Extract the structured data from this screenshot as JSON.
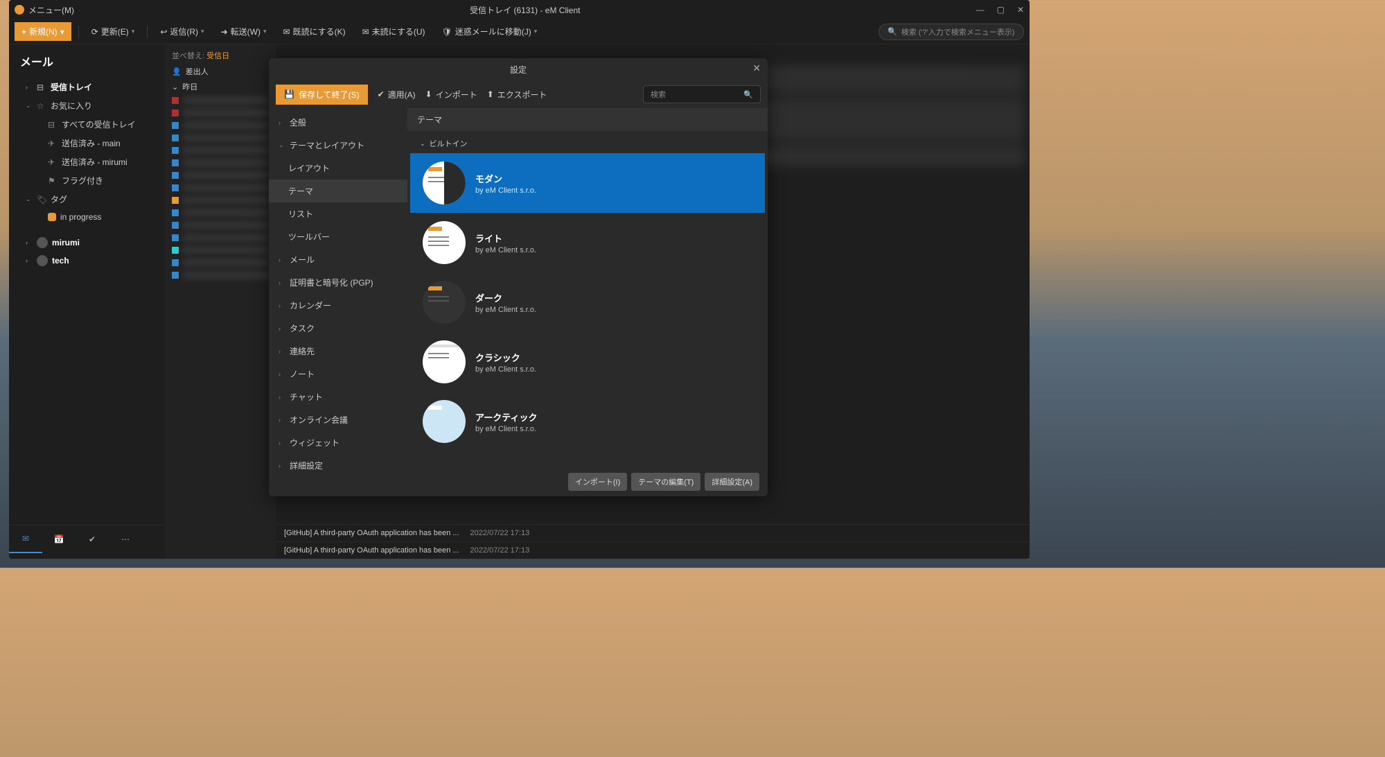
{
  "titlebar": {
    "menu": "メニュー(M)",
    "title": "受信トレイ (6131) - eM Client"
  },
  "toolbar": {
    "new": "新規(N)",
    "refresh": "更新(E)",
    "reply": "返信(R)",
    "forward": "転送(W)",
    "markread": "既読にする(K)",
    "markunread": "未読にする(U)",
    "junk": "迷惑メールに移動(J)",
    "search_ph": "検索 ('?'入力で検索メニュー表示)"
  },
  "sidebar": {
    "title": "メール",
    "inbox": "受信トレイ",
    "fav": "お気に入り",
    "allinbox": "すべての受信トレイ",
    "sent_main": "送信済み - main",
    "sent_mirumi": "送信済み - mirumi",
    "flagged": "フラグ付き",
    "tags": "タグ",
    "inprogress": "in progress",
    "acc1": "mirumi",
    "acc2": "tech"
  },
  "maillist": {
    "sortlabel": "並べ替え:",
    "sortval": "受信日",
    "sender": "差出人",
    "yesterday": "昨日",
    "visible1_subj": "[GitHub] A third-party OAuth application has been ...",
    "visible1_date": "2022/07/22 17:13",
    "visible2_subj": "[GitHub] A third-party OAuth application has been ...",
    "visible2_date": "2022/07/22 17:13"
  },
  "dialog": {
    "title": "設定",
    "save": "保存して終了(S)",
    "apply": "適用(A)",
    "import": "インポート",
    "export": "エクスポート",
    "search_ph": "検索",
    "nav": {
      "general": "全般",
      "themelayout": "テーマとレイアウト",
      "layout": "レイアウト",
      "theme": "テーマ",
      "list": "リスト",
      "toolbar": "ツールバー",
      "mail": "メール",
      "pgp": "証明書と暗号化 (PGP)",
      "calendar": "カレンダー",
      "task": "タスク",
      "contacts": "連絡先",
      "notes": "ノート",
      "chat": "チャット",
      "meeting": "オンライン会議",
      "widget": "ウィジェット",
      "advanced": "詳細設定"
    },
    "main_header": "テーマ",
    "builtin": "ビルトイン",
    "themes": [
      {
        "name": "モダン",
        "author": "by eM Client s.r.o."
      },
      {
        "name": "ライト",
        "author": "by eM Client s.r.o."
      },
      {
        "name": "ダーク",
        "author": "by eM Client s.r.o."
      },
      {
        "name": "クラシック",
        "author": "by eM Client s.r.o."
      },
      {
        "name": "アークティック",
        "author": "by eM Client s.r.o."
      }
    ],
    "footer": {
      "import": "インポート(I)",
      "edit": "テーマの編集(T)",
      "advanced": "詳細設定(A)"
    }
  }
}
